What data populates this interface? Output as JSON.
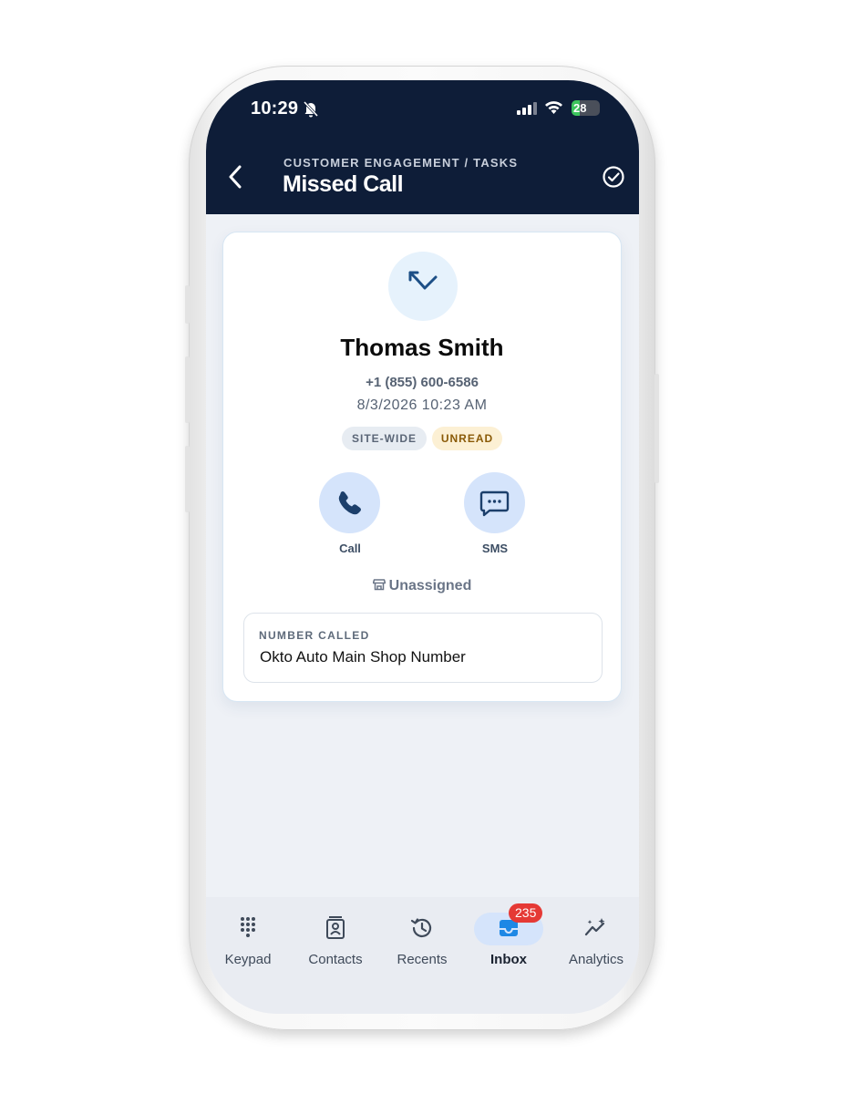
{
  "status_bar": {
    "time": "10:29",
    "battery": "28",
    "battery_level_percent": 28,
    "icons": [
      "bell-off-icon",
      "signal-icon",
      "wifi-icon",
      "battery-icon"
    ]
  },
  "header": {
    "breadcrumb": "CUSTOMER ENGAGEMENT / TASKS",
    "title": "Missed Call",
    "back_icon": "chevron-left-icon",
    "complete_icon": "check-circle-icon"
  },
  "call": {
    "icon": "missed-call-icon",
    "contact_name": "Thomas Smith",
    "phone_number": "+1 (855) 600-6586",
    "datetime": "8/3/2026 10:23 AM",
    "badges": [
      {
        "label": "SITE-WIDE",
        "color": "#5b6677"
      },
      {
        "label": "UNREAD",
        "color": "#8a5a07"
      }
    ],
    "actions": [
      {
        "label": "Call",
        "icon": "phone-icon"
      },
      {
        "label": "SMS",
        "icon": "message-icon"
      }
    ],
    "assignment": "Unassigned",
    "assignment_icon": "store-icon",
    "number_called": {
      "label": "NUMBER CALLED",
      "value": "Okto Auto Main Shop Number"
    }
  },
  "tabs": [
    {
      "label": "Keypad",
      "icon": "keypad-icon"
    },
    {
      "label": "Contacts",
      "icon": "contacts-icon"
    },
    {
      "label": "Recents",
      "icon": "history-icon"
    },
    {
      "label": "Inbox",
      "icon": "inbox-icon",
      "badge": "235",
      "active": true
    },
    {
      "label": "Analytics",
      "icon": "analytics-icon"
    }
  ],
  "colors": {
    "header_bg": "#0e1d38",
    "accent": "#1565c0",
    "badge_red": "#e53935",
    "action_bg": "#d5e4fb"
  }
}
